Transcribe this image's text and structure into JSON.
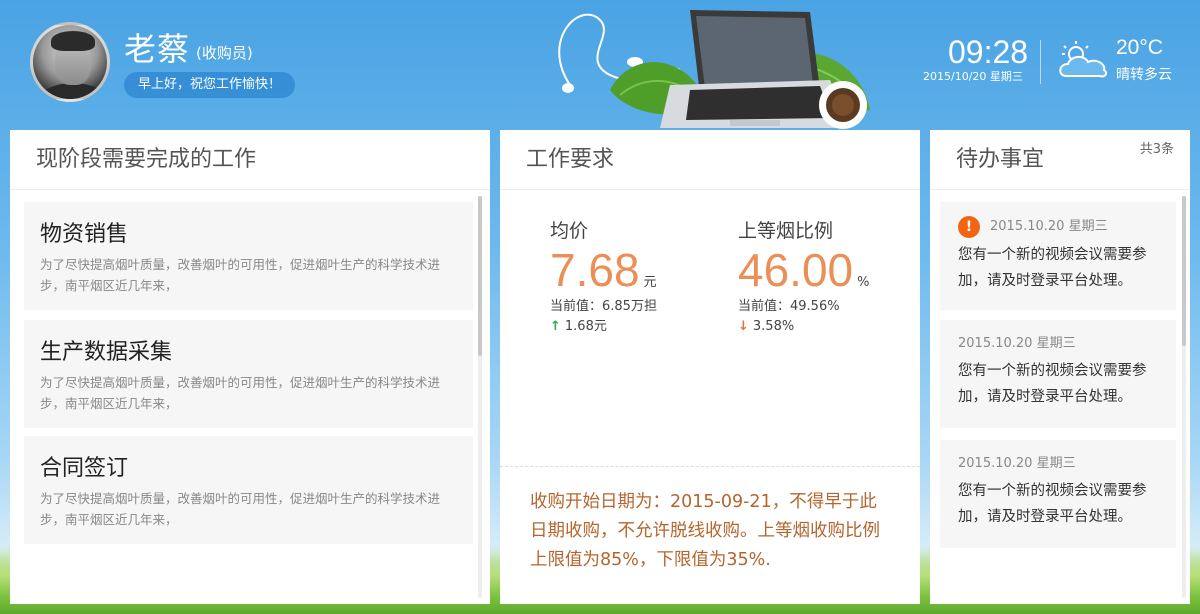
{
  "user": {
    "name": "老蔡",
    "role": "(收购员)",
    "greeting": "早上好，祝您工作愉快！"
  },
  "header": {
    "time": "09:28",
    "date": "2015/10/20  星期三",
    "temperature": "20°C",
    "weather": "晴转多云",
    "weather_icon": "partly-cloudy-icon"
  },
  "work_panel": {
    "title": "现阶段需要完成的工作",
    "tasks": [
      {
        "title": "物资销售",
        "desc": "为了尽快提高烟叶质量，改善烟叶的可用性，促进烟叶生产的科学技术进步，南平烟区近几年来，"
      },
      {
        "title": "生产数据采集",
        "desc": "为了尽快提高烟叶质量，改善烟叶的可用性，促进烟叶生产的科学技术进步，南平烟区近几年来，"
      },
      {
        "title": "合同签订",
        "desc": "为了尽快提高烟叶质量，改善烟叶的可用性，促进烟叶生产的科学技术进步，南平烟区近几年来，"
      }
    ]
  },
  "requirements_panel": {
    "title": "工作要求",
    "metrics": [
      {
        "label": "均价",
        "value": "7.68",
        "unit": "元",
        "current": "当前值：6.85万担",
        "delta": "1.68元",
        "trend": "up"
      },
      {
        "label": "上等烟比例",
        "value": "46.00",
        "unit": "%",
        "current": "当前值：49.56%",
        "delta": "3.58%",
        "trend": "down"
      }
    ],
    "notice": "收购开始日期为：2015-09-21，不得早于此日期收购，不允许脱线收购。上等烟收购比例上限值为85%，下限值为35%."
  },
  "todo_panel": {
    "title": "待办事宜",
    "count": "共3条",
    "items": [
      {
        "date": "2015.10.20 星期三",
        "text": "您有一个新的视频会议需要参加，请及时登录平台处理。",
        "urgent": true
      },
      {
        "date": "2015.10.20 星期三",
        "text": "您有一个新的视频会议需要参加，请及时登录平台处理。",
        "urgent": false
      },
      {
        "date": "2015.10.20 星期三",
        "text": "您有一个新的视频会议需要参加，请及时登录平台处理。",
        "urgent": false
      }
    ]
  },
  "colors": {
    "accent_orange": "#ec8f57",
    "notice_brown": "#b5652d",
    "alert_orange": "#f06414",
    "up_green": "#2fa84f",
    "down_orange": "#e8703a"
  }
}
